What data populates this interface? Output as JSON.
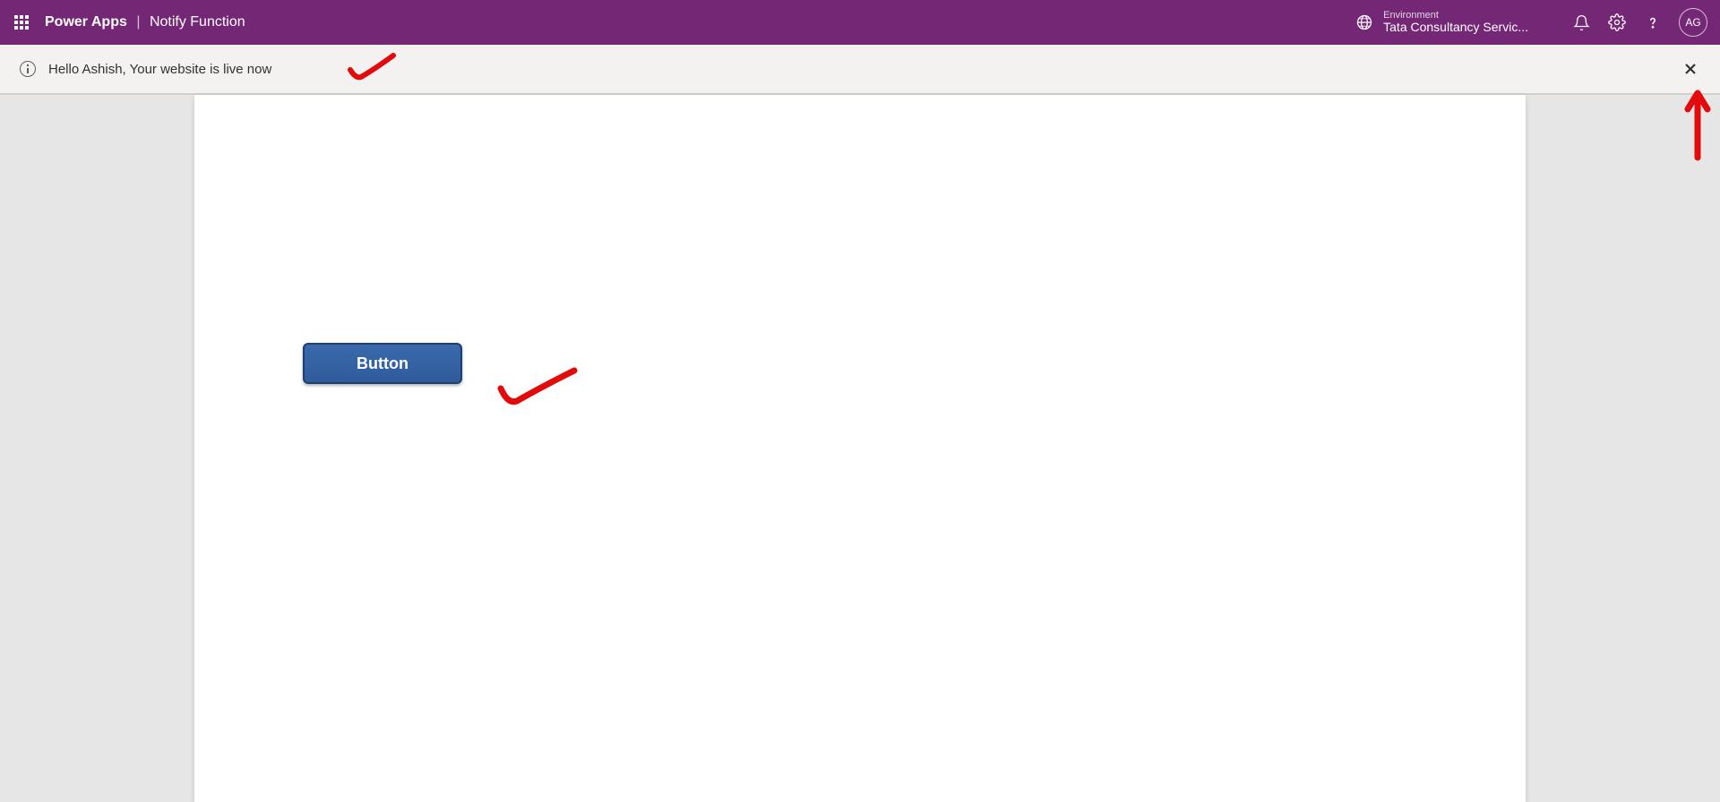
{
  "header": {
    "brand": "Power Apps",
    "separator": "|",
    "page_title": "Notify Function",
    "environment_label": "Environment",
    "environment_value": "Tata Consultancy Servic...",
    "avatar_initials": "AG"
  },
  "notification": {
    "message": "Hello Ashish, Your website is live now"
  },
  "canvas": {
    "button_label": "Button"
  }
}
